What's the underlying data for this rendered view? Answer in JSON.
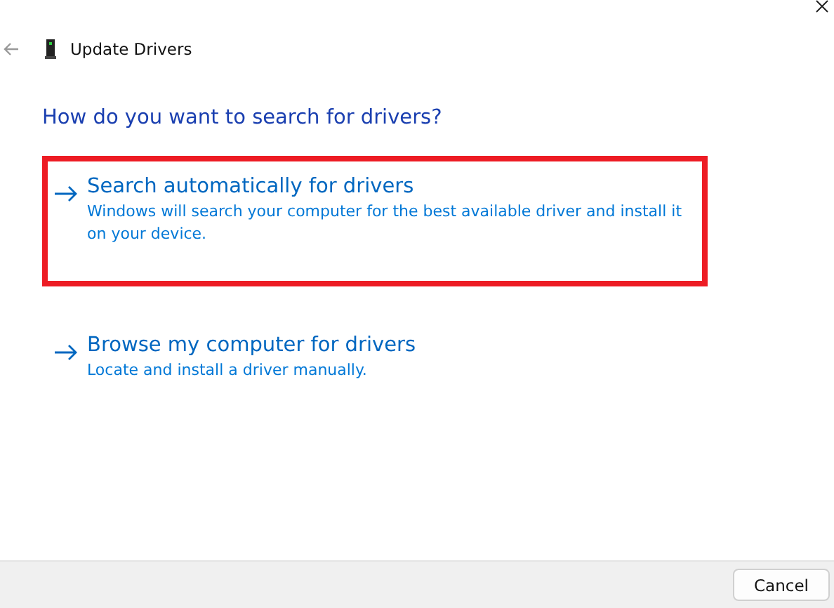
{
  "window": {
    "title": "Update Drivers"
  },
  "heading": "How do you want to search for drivers?",
  "options": [
    {
      "title": "Search automatically for drivers",
      "description": "Windows will search your computer for the best available driver and install it on your device.",
      "highlighted": true
    },
    {
      "title": "Browse my computer for drivers",
      "description": "Locate and install a driver manually.",
      "highlighted": false
    }
  ],
  "buttons": [
    "Cancel"
  ]
}
